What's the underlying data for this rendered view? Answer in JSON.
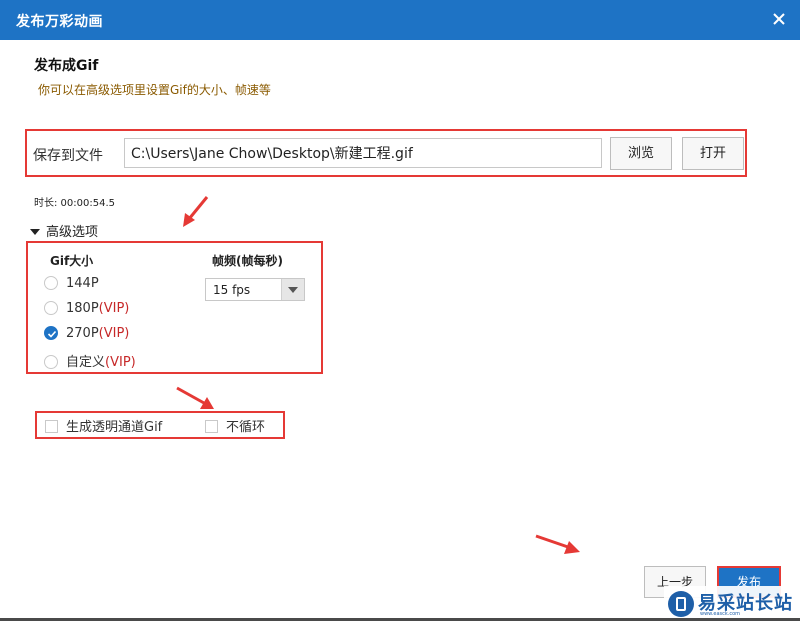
{
  "window": {
    "title": "发布万彩动画",
    "close_icon": "close-icon"
  },
  "header": {
    "heading": "发布成Gif",
    "subtitle": "你可以在高级选项里设置Gif的大小、帧速等"
  },
  "save": {
    "label": "保存到文件",
    "path_value": "C:\\Users\\Jane Chow\\Desktop\\新建工程.gif",
    "browse_label": "浏览",
    "open_label": "打开"
  },
  "duration": "时长: 00:00:54.5",
  "advanced": {
    "toggle_label": "高级选项",
    "gif_size_label": "Gif大小",
    "sizes": [
      {
        "label": "144P",
        "vip": "",
        "checked": false
      },
      {
        "label": "180P",
        "vip": "(VIP)",
        "checked": false
      },
      {
        "label": "270P",
        "vip": "(VIP)",
        "checked": true
      },
      {
        "label": "自定义",
        "vip": "(VIP)",
        "checked": false
      }
    ],
    "fps_label": "帧频(帧每秒)",
    "fps_value": "15 fps"
  },
  "options": {
    "transparent_label": "生成透明通道Gif",
    "no_loop_label": "不循环",
    "transparent_checked": false,
    "no_loop_checked": false
  },
  "footer": {
    "prev_label": "上一步",
    "publish_label": "发布"
  },
  "watermark": {
    "text": "易采站长站",
    "sub": "www.easck.com"
  },
  "colors": {
    "title_bar": "#1e73c5",
    "highlight_red": "#e53935",
    "vip_red": "#c62828",
    "subtitle_brown": "#8a5a00"
  }
}
